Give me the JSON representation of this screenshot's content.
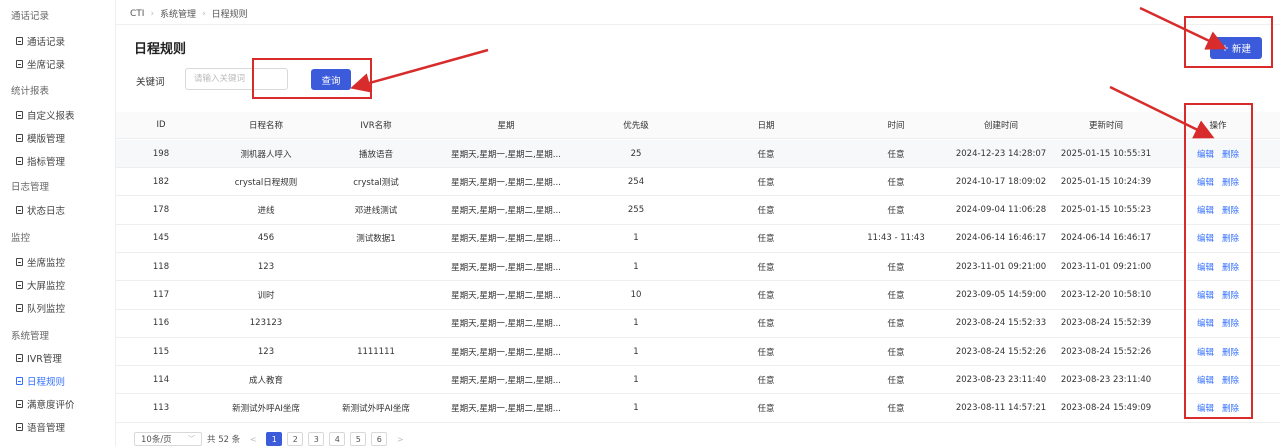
{
  "sidebar": {
    "groups": [
      {
        "label": "通话记录",
        "items": [
          "通话记录",
          "坐席记录"
        ]
      },
      {
        "label": "统计报表",
        "items": [
          "自定义报表",
          "模版管理",
          "指标管理"
        ]
      },
      {
        "label": "日志管理",
        "items": [
          "状态日志"
        ]
      },
      {
        "label": "监控",
        "items": [
          "坐席监控",
          "大屏监控",
          "队列监控"
        ]
      },
      {
        "label": "系统管理",
        "items": [
          "IVR管理",
          "日程规则",
          "满意度评价",
          "语音管理"
        ]
      }
    ],
    "active_item": "日程规则"
  },
  "breadcrumb": [
    "CTI",
    "系统管理",
    "日程规则"
  ],
  "page_title": "日程规则",
  "search": {
    "label": "关键词",
    "placeholder": "请输入关键词",
    "button": "查询"
  },
  "new_button": {
    "icon": "plus-icon",
    "label": "新建"
  },
  "table": {
    "columns": [
      "ID",
      "日程名称",
      "IVR名称",
      "星期",
      "优先级",
      "日期",
      "时间",
      "创建时间",
      "更新时间",
      "操作"
    ],
    "actions": [
      "编辑",
      "删除"
    ],
    "rows": [
      [
        "198",
        "测机器人呼入",
        "播放语音",
        "星期天,星期一,星期二,星期...",
        "25",
        "任意",
        "任意",
        "2024-12-23 14:28:07",
        "2025-01-15 10:55:31"
      ],
      [
        "182",
        "crystal日程规则",
        "crystal测试",
        "星期天,星期一,星期二,星期...",
        "254",
        "任意",
        "任意",
        "2024-10-17 18:09:02",
        "2025-01-15 10:24:39"
      ],
      [
        "178",
        "进线",
        "邓进线测试",
        "星期天,星期一,星期二,星期...",
        "255",
        "任意",
        "任意",
        "2024-09-04 11:06:28",
        "2025-01-15 10:55:23"
      ],
      [
        "145",
        "456",
        "测试数据1",
        "星期天,星期一,星期二,星期...",
        "1",
        "任意",
        "11:43 - 11:43",
        "2024-06-14 16:46:17",
        "2024-06-14 16:46:17"
      ],
      [
        "118",
        "123",
        "",
        "星期天,星期一,星期二,星期...",
        "1",
        "任意",
        "任意",
        "2023-11-01 09:21:00",
        "2023-11-01 09:21:00"
      ],
      [
        "117",
        "训时",
        "",
        "星期天,星期一,星期二,星期...",
        "10",
        "任意",
        "任意",
        "2023-09-05 14:59:00",
        "2023-12-20 10:58:10"
      ],
      [
        "116",
        "123123",
        "",
        "星期天,星期一,星期二,星期...",
        "1",
        "任意",
        "任意",
        "2023-08-24 15:52:33",
        "2023-08-24 15:52:39"
      ],
      [
        "115",
        "123",
        "1111111",
        "星期天,星期一,星期二,星期...",
        "1",
        "任意",
        "任意",
        "2023-08-24 15:52:26",
        "2023-08-24 15:52:26"
      ],
      [
        "114",
        "成人教育",
        "",
        "星期天,星期一,星期二,星期...",
        "1",
        "任意",
        "任意",
        "2023-08-23 23:11:40",
        "2023-08-23 23:11:40"
      ],
      [
        "113",
        "新测试外呼AI坐席",
        "新测试外呼AI坐席",
        "星期天,星期一,星期二,星期...",
        "1",
        "任意",
        "任意",
        "2023-08-11 14:57:21",
        "2023-08-24 15:49:09"
      ]
    ]
  },
  "pagination": {
    "page_size": "10条/页",
    "total": "共 52 条",
    "pages": [
      "1",
      "2",
      "3",
      "4",
      "5",
      "6"
    ],
    "current": "1",
    "prev": "<",
    "next": ">"
  },
  "colors": {
    "accent": "#3b5bdb",
    "link": "#3370ff",
    "annotation": "#d82c2c"
  }
}
